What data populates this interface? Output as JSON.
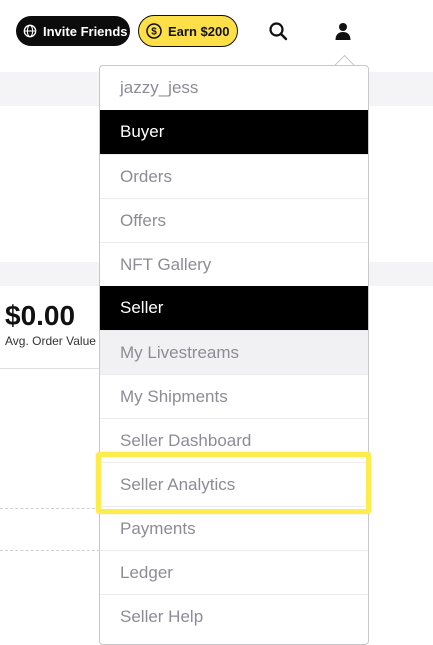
{
  "header": {
    "invite_label": "Invite Friends",
    "earn_label": "Earn $200"
  },
  "background": {
    "stat_value": "$0.00",
    "stat_label": "Avg. Order Value"
  },
  "account_menu": {
    "username": "jazzy_jess",
    "buyer_section": "Buyer",
    "buyer_items": [
      "Orders",
      "Offers",
      "NFT Gallery"
    ],
    "seller_section": "Seller",
    "seller_items": [
      "My Livestreams",
      "My Shipments",
      "Seller Dashboard",
      "Seller Analytics",
      "Payments",
      "Ledger",
      "Seller Help"
    ],
    "highlighted_item": "Seller Analytics"
  },
  "colors": {
    "accent_yellow": "#fde047",
    "highlight_outline": "#fcec4d",
    "section_header_bg": "#000000",
    "menu_text": "#8c8c96"
  },
  "icons": {
    "invite": "globe-icon",
    "earn": "dollar-coin-icon",
    "search": "search-icon",
    "account": "user-icon"
  }
}
